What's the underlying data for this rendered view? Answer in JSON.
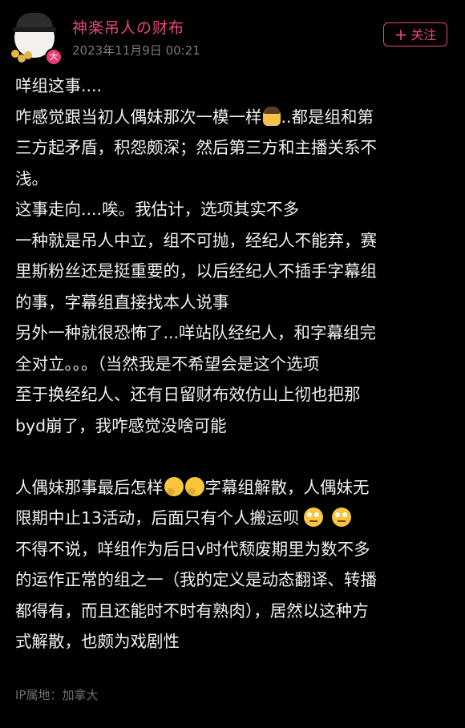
{
  "post": {
    "author": {
      "name": "神楽吊人の财布",
      "avatar_badge": "大"
    },
    "timestamp": "2023年11月9日 00:21",
    "follow_label": "关注",
    "ip_location": "IP属地：加拿大"
  },
  "content": {
    "lines": [
      "咩组这事....",
      "咋感觉跟当初人偶妹那次一模一样",
      "..都是组和第",
      "三方起矛盾，积怨颇深；然后第三方和主播关系不",
      "浅。",
      "这事走向....唉。我估计，选项其实不多",
      "一种就是吊人中立，组不可抛，经纪人不能弃，赛",
      "里斯粉丝还是挺重要的，以后经纪人不插手字幕组",
      "的事，字幕组直接找本人说事",
      "另外一种就很恐怖了...咩站队经纪人，和字幕组完",
      "全对立。。。（当然我是不希望会是这个选项",
      "至于换经纪人、还有日留财布效仿山上彻也把那",
      "byd崩了，我咋感觉没啥可能",
      "人偶妹那事最后怎样",
      "字幕组解散，人偶妹无",
      "限期中止13活动，后面只有个人搬运呗",
      "不得不说，咩组作为后日v时代颓废期里为数不多",
      "的运作正常的组之一（我的定义是动态翻译、转播",
      "都得有，而且还能时不时有熟肉），居然以这种方",
      "式解散，也颇为戏剧性"
    ]
  },
  "colors": {
    "accent": "#e8477d",
    "background": "#000000",
    "text": "#f0f0f0",
    "muted": "#7a7a7a"
  },
  "icons": [
    "facepalm-emoji-icon",
    "thinking-emoji-icon",
    "eye-roll-emoji-icon",
    "plus-icon"
  ]
}
